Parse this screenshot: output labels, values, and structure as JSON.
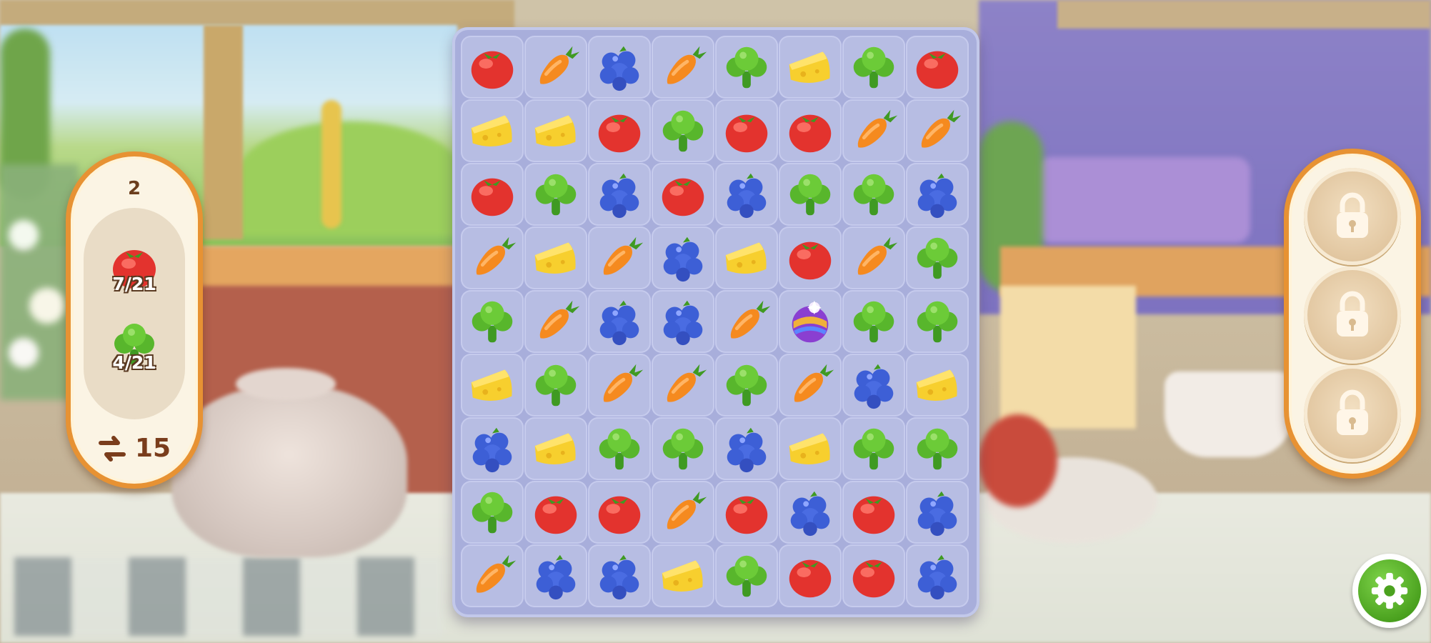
{
  "level": {
    "number": "2"
  },
  "goals": [
    {
      "item": "tomato",
      "count": "7/21"
    },
    {
      "item": "broccoli",
      "count": "4/21"
    }
  ],
  "moves": {
    "icon": "swap-arrows-icon",
    "count": "15"
  },
  "boosters": [
    {
      "state": "locked",
      "icon": "lock-icon"
    },
    {
      "state": "locked",
      "icon": "lock-icon"
    },
    {
      "state": "locked",
      "icon": "lock-icon"
    }
  ],
  "settings": {
    "icon": "gear-icon"
  },
  "board": {
    "columns": 8,
    "rows": [
      [
        "tomato",
        "carrot",
        "blueberry",
        "carrot",
        "broccoli",
        "cheese",
        "broccoli",
        "tomato"
      ],
      [
        "cheese",
        "cheese",
        "tomato",
        "broccoli",
        "tomato",
        "tomato",
        "carrot",
        "carrot"
      ],
      [
        "tomato",
        "broccoli",
        "blueberry",
        "tomato",
        "blueberry",
        "broccoli",
        "broccoli",
        "blueberry"
      ],
      [
        "carrot",
        "cheese",
        "carrot",
        "blueberry",
        "cheese",
        "tomato",
        "carrot",
        "broccoli"
      ],
      [
        "broccoli",
        "carrot",
        "blueberry",
        "blueberry",
        "carrot",
        "rainbow-orb",
        "broccoli",
        "broccoli"
      ],
      [
        "cheese",
        "broccoli",
        "carrot",
        "carrot",
        "broccoli",
        "carrot",
        "blueberry",
        "cheese"
      ],
      [
        "blueberry",
        "cheese",
        "broccoli",
        "broccoli",
        "blueberry",
        "cheese",
        "broccoli",
        "broccoli"
      ],
      [
        "broccoli",
        "tomato",
        "tomato",
        "carrot",
        "tomato",
        "blueberry",
        "tomato",
        "blueberry"
      ],
      [
        "carrot",
        "blueberry",
        "blueberry",
        "cheese",
        "broccoli",
        "tomato",
        "tomato",
        "blueberry"
      ]
    ]
  },
  "colors": {
    "panel_border": "#e79233",
    "panel_bg": "#fbf4e4",
    "board_bg": "#a8aedb",
    "tile_bg": "#b7bde3",
    "tomato": "#e3332e",
    "carrot": "#f58a1f",
    "blueberry": "#3d5fd6",
    "broccoli": "#58b62c",
    "cheese": "#f7cf2e",
    "settings_green": "#4ba21f"
  }
}
